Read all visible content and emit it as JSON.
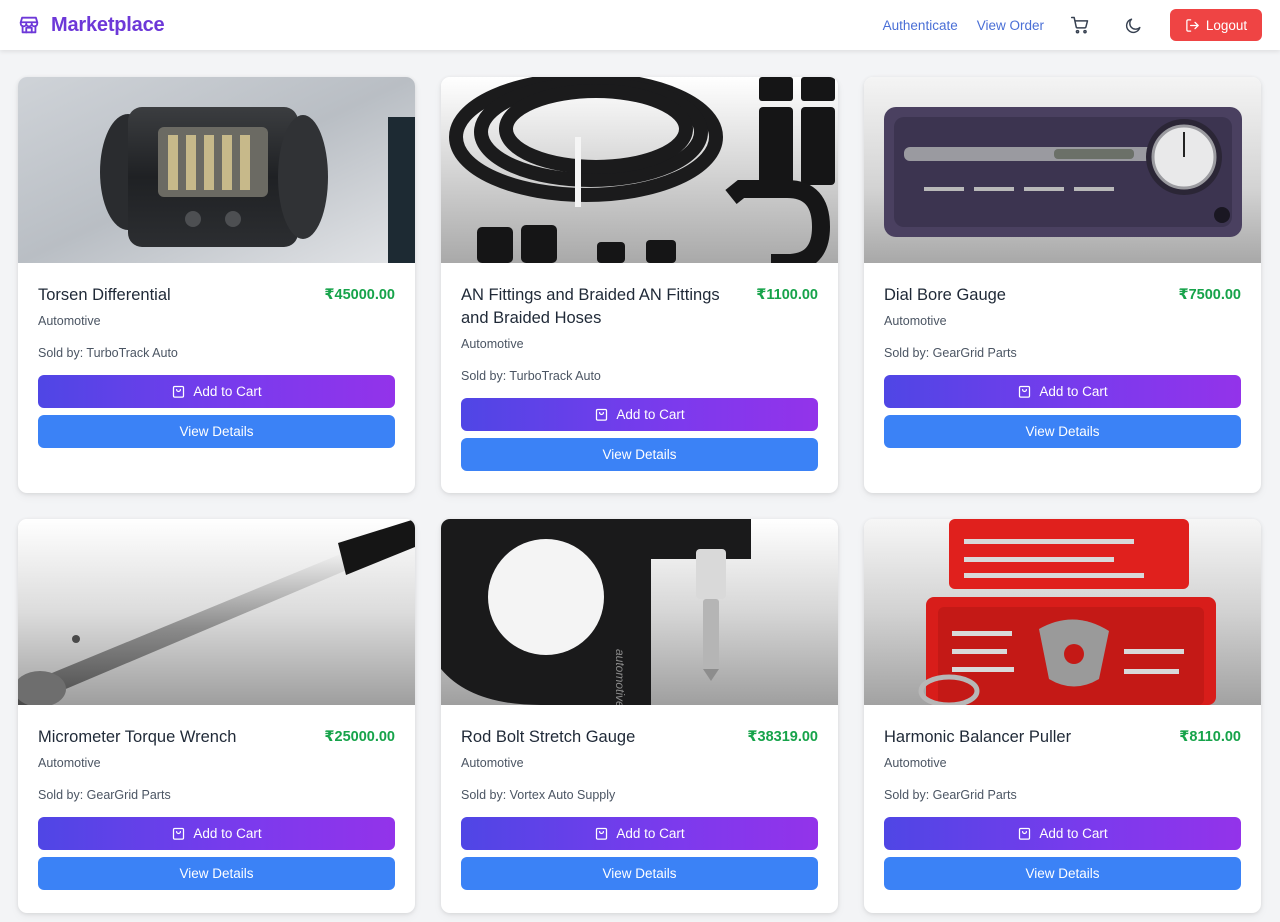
{
  "header": {
    "brand": "Marketplace",
    "brand_icon": "storefront-icon",
    "nav": {
      "authenticate": "Authenticate",
      "view_order": "View Order"
    },
    "cart_icon": "cart-icon",
    "theme_icon": "moon-icon",
    "logout_label": "Logout",
    "logout_icon": "logout-icon"
  },
  "colors": {
    "brand": "#6d38d8",
    "link": "#4a6fd6",
    "price": "#16a34a",
    "add_to_cart_gradient_start": "#4f46e5",
    "add_to_cart_gradient_end": "#9333ea",
    "view_details": "#3b82f6",
    "logout": "#ef4444"
  },
  "products": [
    {
      "title": "Torsen Differential",
      "price": "₹45000.00",
      "category": "Automotive",
      "seller": "Sold by: TurboTrack Auto",
      "add_to_cart": "Add to Cart",
      "view_details": "View Details",
      "image": "differential-photo"
    },
    {
      "title": "AN Fittings and Braided AN Fittings and Braided Hoses",
      "price": "₹1100.00",
      "category": "Automotive",
      "seller": "Sold by: TurboTrack Auto",
      "add_to_cart": "Add to Cart",
      "view_details": "View Details",
      "image": "braided-hose-photo"
    },
    {
      "title": "Dial Bore Gauge",
      "price": "₹7500.00",
      "category": "Automotive",
      "seller": "Sold by: GearGrid Parts",
      "add_to_cart": "Add to Cart",
      "view_details": "View Details",
      "image": "bore-gauge-photo"
    },
    {
      "title": "Micrometer Torque Wrench",
      "price": "₹25000.00",
      "category": "Automotive",
      "seller": "Sold by: GearGrid Parts",
      "add_to_cart": "Add to Cart",
      "view_details": "View Details",
      "image": "torque-wrench-photo"
    },
    {
      "title": "Rod Bolt Stretch Gauge",
      "price": "₹38319.00",
      "category": "Automotive",
      "seller": "Sold by: Vortex Auto Supply",
      "add_to_cart": "Add to Cart",
      "view_details": "View Details",
      "image": "stretch-gauge-photo",
      "image_text": "automotive"
    },
    {
      "title": "Harmonic Balancer Puller",
      "price": "₹8110.00",
      "category": "Automotive",
      "seller": "Sold by: GearGrid Parts",
      "add_to_cart": "Add to Cart",
      "view_details": "View Details",
      "image": "puller-kit-photo"
    }
  ]
}
